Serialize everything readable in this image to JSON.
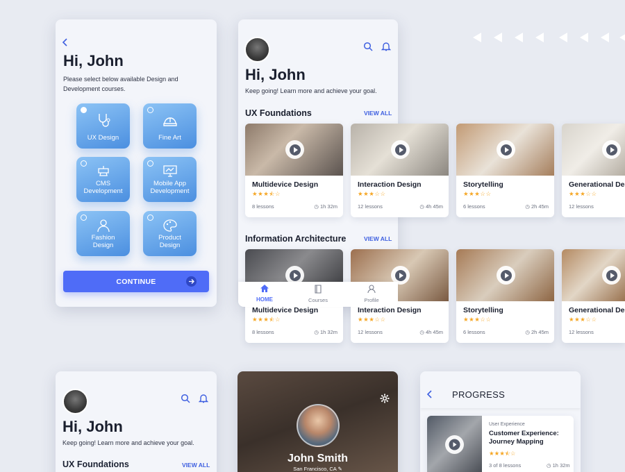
{
  "screen1": {
    "greeting": "Hi, John",
    "instructions": "Please select below available Design and Development courses.",
    "categories": [
      "UX Design",
      "Fine Art",
      "CMS Development",
      "Mobile App Development",
      "Fashion Design",
      "Product Design"
    ],
    "categories_lines": [
      [
        "UX Design"
      ],
      [
        "Fine Art"
      ],
      [
        "CMS",
        "Development"
      ],
      [
        "Mobile App",
        "Development"
      ],
      [
        "Fashion",
        "Design"
      ],
      [
        "Product",
        "Design"
      ]
    ],
    "continue_label": "CONTINUE"
  },
  "screen2": {
    "greeting": "Hi, John",
    "subtitle": "Keep going! Learn more and achieve your goal.",
    "section1": "UX Foundations",
    "section2": "Information Architecture",
    "view_all": "VIEW ALL",
    "courses": [
      {
        "title": "Multidevice Design",
        "stars": "★★★⯪☆",
        "rating": 3.5,
        "lessons": "8 lessons",
        "duration": "1h 32m"
      },
      {
        "title": "Interaction Design",
        "stars": "★★★☆☆",
        "rating": 3,
        "lessons": "12 lessons",
        "duration": "4h 45m"
      },
      {
        "title": "Storytelling",
        "stars": "★★★☆☆",
        "rating": 3,
        "lessons": "6 lessons",
        "duration": "2h 45m"
      },
      {
        "title": "Generational De",
        "stars": "★★★☆☆",
        "rating": 3,
        "lessons": "12 lessons",
        "duration": ""
      }
    ],
    "nav": {
      "home": "HOME",
      "courses": "Courses",
      "profile": "Profile"
    }
  },
  "screen3": {
    "greeting": "Hi, John",
    "subtitle": "Keep going! Learn more and achieve your goal.",
    "section1": "UX Foundations",
    "view_all": "VIEW ALL"
  },
  "screen4": {
    "name": "John Smith",
    "location": "San Francisco, CA"
  },
  "screen5": {
    "title": "PROGRESS",
    "category": "User Experience",
    "course_title": "Customer Experience: Journey Mapping",
    "course_title_lines": [
      "Customer Experience:",
      "Journey Mapping"
    ],
    "stars": "★★★⯪☆",
    "lessons": "3 of 8 lessons",
    "duration": "1h 32m"
  },
  "colors": {
    "accent": "#4f6cf7",
    "tile": "#5b9be6",
    "star": "#f5a623",
    "background": "#e8ebf2"
  }
}
